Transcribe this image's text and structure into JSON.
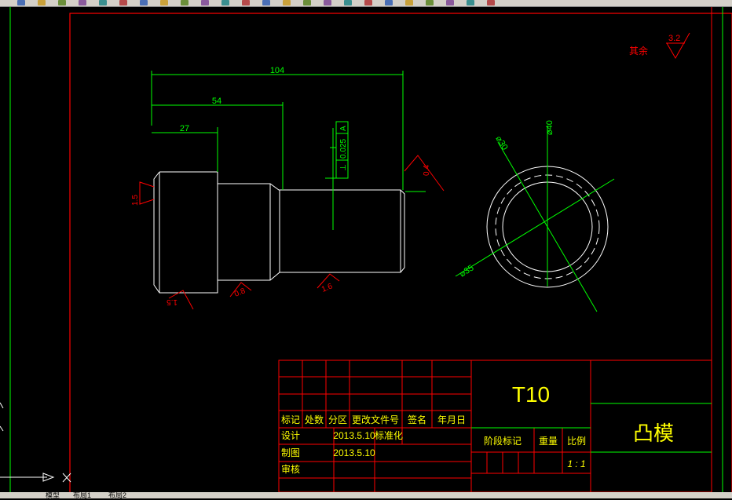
{
  "colors": {
    "background": "#000000",
    "frame": "#ff0000",
    "title_block_lines": "#ff0000",
    "title_block_text": "#ffff00",
    "dimensions": "#00ff00",
    "part_outline": "#ffffff",
    "roughness": "#ff0000",
    "tolerance": "#00ff00"
  },
  "toolbar": {
    "icons": [
      "new-icon",
      "open-icon",
      "save-icon",
      "print-icon",
      "preview-icon",
      "cut-icon",
      "copy-icon",
      "paste-icon",
      "match-icon",
      "undo-icon",
      "redo-icon",
      "pan-icon",
      "zoom-realtime-icon",
      "zoom-window-icon",
      "zoom-previous-icon",
      "properties-icon",
      "design-center-icon",
      "tool-palette-icon",
      "sheet-set-icon",
      "markup-icon",
      "calc-icon",
      "help-icon",
      "layer-icon",
      "layer-state-icon"
    ]
  },
  "layout_tabs": {
    "model": "模型",
    "layout1": "布局1",
    "layout2": "布局2"
  },
  "drawing": {
    "dimensions": {
      "overall_length": "104",
      "middle_length": "54",
      "head_length": "27",
      "outer_diameter": "⌀40",
      "inner_circle_diameter": "⌀30",
      "diagonal_diameter": "⌀35"
    },
    "tolerance": {
      "symbol": "⊥",
      "value": "0.025",
      "datum": "A"
    },
    "roughness": {
      "head_face": "1.5",
      "bottom_head": "1.5",
      "middle": "0.8",
      "shaft": "1.6",
      "right_end": "0.4",
      "general_label": "其余",
      "general_value": "3.2"
    }
  },
  "title_block": {
    "part_code": "T10",
    "part_name": "凸模",
    "headers": {
      "mark": "标记",
      "count": "处数",
      "zone": "分区",
      "change_doc": "更改文件号",
      "signature": "签名",
      "date": "年月日"
    },
    "rows": [
      {
        "label": "设计",
        "date": "2013.5.10",
        "extra": "标准化"
      },
      {
        "label": "制图",
        "date": "2013.5.10",
        "extra": ""
      },
      {
        "label": "审核",
        "date": "",
        "extra": ""
      }
    ],
    "stage_mark": "阶段标记",
    "weight": "重量",
    "scale_label": "比例",
    "scale_value": "1 : 1"
  }
}
